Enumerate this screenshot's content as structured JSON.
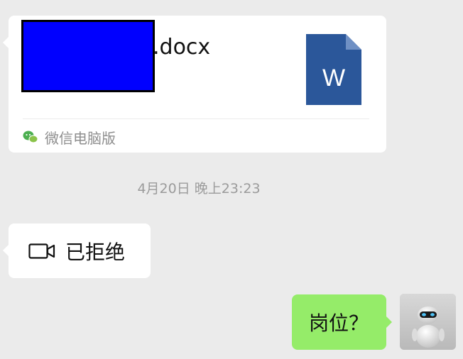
{
  "file_message": {
    "filename_ext": ".docx",
    "file_type_letter": "W",
    "source_label": "微信电脑版",
    "icon": "word-document-icon",
    "source_icon": "wechat-icon",
    "icon_color": "#2b579a"
  },
  "timestamp": "4月20日 晚上23:23",
  "call_message": {
    "label": "已拒绝",
    "icon": "video-camera-icon"
  },
  "outgoing_message": {
    "text": "岗位？",
    "bubble_color": "#95ec69"
  },
  "colors": {
    "background": "#ebebeb",
    "incoming_bubble": "#ffffff",
    "redaction": "#0000ff"
  }
}
